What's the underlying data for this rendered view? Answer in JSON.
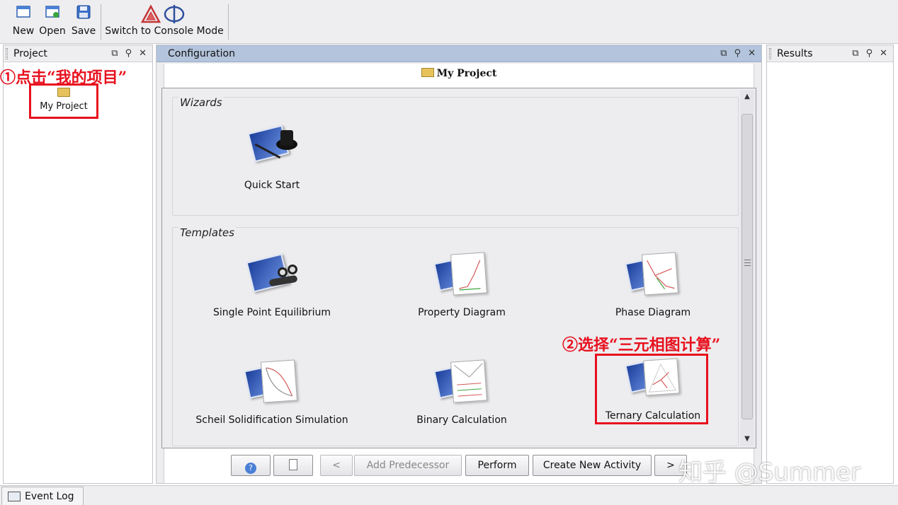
{
  "toolbar": {
    "new_label": "New",
    "open_label": "Open",
    "save_label": "Save",
    "console_label": "Switch to Console Mode"
  },
  "panels": {
    "project": {
      "title": "Project",
      "item_label": "My Project"
    },
    "configuration": {
      "title": "Configuration",
      "header_title": "My Project"
    },
    "results": {
      "title": "Results"
    }
  },
  "wizards": {
    "label": "Wizards",
    "items": [
      {
        "label": "Quick Start",
        "icon": "quick-start-icon"
      }
    ]
  },
  "templates": {
    "label": "Templates",
    "items": [
      {
        "label": "Single Point Equilibrium",
        "icon": "single-point-icon"
      },
      {
        "label": "Property Diagram",
        "icon": "property-diagram-icon"
      },
      {
        "label": "Phase Diagram",
        "icon": "phase-diagram-icon"
      },
      {
        "label": "Scheil Solidification Simulation",
        "icon": "scheil-icon"
      },
      {
        "label": "Binary Calculation",
        "icon": "binary-icon"
      },
      {
        "label": "Ternary Calculation",
        "icon": "ternary-icon"
      }
    ]
  },
  "buttons": {
    "prev": "<",
    "add_predecessor": "Add Predecessor",
    "perform": "Perform",
    "create_new_activity": "Create New Activity",
    "next": ">"
  },
  "status": {
    "event_log": "Event Log"
  },
  "annotations": {
    "step1": "①点击“我的项目”",
    "step2": "②选择“三元相图计算”"
  },
  "watermark": "知乎 @Summer",
  "colors": {
    "annotation": "#e8101e",
    "active_header": "#b3c4dc"
  }
}
